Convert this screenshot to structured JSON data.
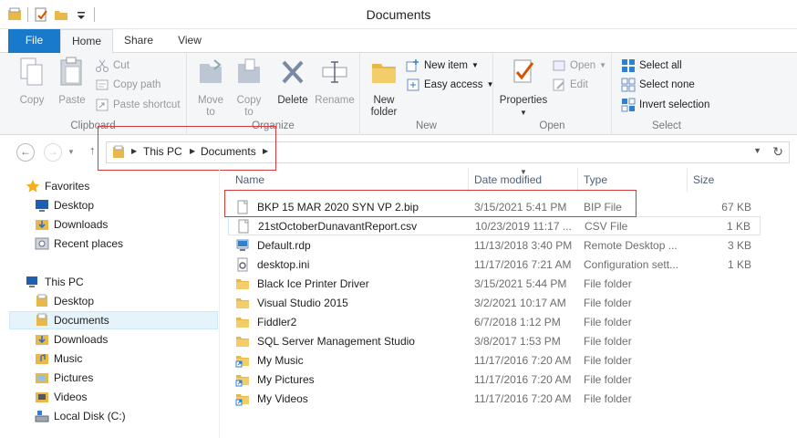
{
  "window": {
    "title": "Documents"
  },
  "ribbon": {
    "tabs": {
      "file": "File",
      "home": "Home",
      "share": "Share",
      "view": "View"
    },
    "clipboard": {
      "label": "Clipboard",
      "copy": "Copy",
      "paste": "Paste",
      "cut": "Cut",
      "copy_path": "Copy path",
      "paste_shortcut": "Paste shortcut"
    },
    "organize": {
      "label": "Organize",
      "move_to_1": "Move",
      "move_to_2": "to",
      "copy_to_1": "Copy",
      "copy_to_2": "to",
      "delete": "Delete",
      "rename": "Rename"
    },
    "new": {
      "label": "New",
      "new_folder_1": "New",
      "new_folder_2": "folder",
      "new_item": "New item",
      "easy_access": "Easy access"
    },
    "open": {
      "label": "Open",
      "properties": "Properties",
      "open": "Open",
      "edit": "Edit"
    },
    "select": {
      "label": "Select",
      "select_all": "Select all",
      "select_none": "Select none",
      "invert": "Invert selection"
    }
  },
  "address": {
    "crumbs": [
      "This PC",
      "Documents"
    ]
  },
  "nav": {
    "favorites": "Favorites",
    "fav_items": [
      "Desktop",
      "Downloads",
      "Recent places"
    ],
    "this_pc": "This PC",
    "pc_items": [
      "Desktop",
      "Documents",
      "Downloads",
      "Music",
      "Pictures",
      "Videos",
      "Local Disk (C:)"
    ]
  },
  "columns": {
    "name": "Name",
    "date": "Date modified",
    "type": "Type",
    "size": "Size"
  },
  "files": [
    {
      "name": "BKP 15 MAR 2020 SYN VP 2.bip",
      "date": "3/15/2021 5:41 PM",
      "type": "BIP File",
      "size": "67 KB",
      "icon": "blank-file-icon"
    },
    {
      "name": "21stOctoberDunavantReport.csv",
      "date": "10/23/2019 11:17 ...",
      "type": "CSV File",
      "size": "1 KB",
      "icon": "blank-file-icon"
    },
    {
      "name": "Default.rdp",
      "date": "11/13/2018 3:40 PM",
      "type": "Remote Desktop ...",
      "size": "3 KB",
      "icon": "rdp-icon"
    },
    {
      "name": "desktop.ini",
      "date": "11/17/2016 7:21 AM",
      "type": "Configuration sett...",
      "size": "1 KB",
      "icon": "settings-file-icon"
    },
    {
      "name": "Black Ice Printer Driver",
      "date": "3/15/2021 5:44 PM",
      "type": "File folder",
      "size": "",
      "icon": "folder-icon"
    },
    {
      "name": "Visual Studio 2015",
      "date": "3/2/2021 10:17 AM",
      "type": "File folder",
      "size": "",
      "icon": "folder-icon"
    },
    {
      "name": "Fiddler2",
      "date": "6/7/2018 1:12 PM",
      "type": "File folder",
      "size": "",
      "icon": "folder-icon"
    },
    {
      "name": "SQL Server Management Studio",
      "date": "3/8/2017 1:53 PM",
      "type": "File folder",
      "size": "",
      "icon": "folder-icon"
    },
    {
      "name": "My Music",
      "date": "11/17/2016 7:20 AM",
      "type": "File folder",
      "size": "",
      "icon": "shortcut-folder-icon"
    },
    {
      "name": "My Pictures",
      "date": "11/17/2016 7:20 AM",
      "type": "File folder",
      "size": "",
      "icon": "shortcut-folder-icon"
    },
    {
      "name": "My Videos",
      "date": "11/17/2016 7:20 AM",
      "type": "File folder",
      "size": "",
      "icon": "shortcut-folder-icon"
    }
  ],
  "colors": {
    "accent": "#1979ca",
    "highlight_box": "#d23b3b",
    "folder": "#e8b84a"
  }
}
